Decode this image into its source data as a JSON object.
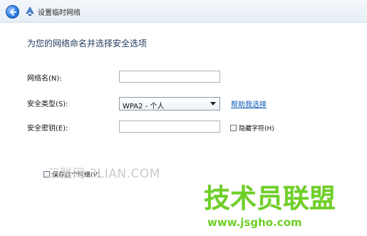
{
  "window": {
    "title": "设置临时网络",
    "back_icon": "back-arrow-icon",
    "network_icon": "network-icon"
  },
  "main": {
    "heading": "为您的网络命名并选择安全选项",
    "network_name_label": "网络名(N):",
    "network_name_value": "",
    "security_type_label": "安全类型(S):",
    "security_type_value": "WPA2 - 个人",
    "help_link": "帮助我选择",
    "security_key_label": "安全密钥(E):",
    "security_key_value": "",
    "hide_chars_label": "隐藏字符(H)",
    "save_network_label": "保存这个网络(V)"
  },
  "watermarks": {
    "site_text": "三联网 3LIAN.COM",
    "brand_text": "技术员联盟",
    "brand_url": "www.jsgho.com"
  },
  "colors": {
    "heading": "#1e395b",
    "link": "#0b57b3",
    "watermark_green": "#6ecf26",
    "watermark_gray": "#c9cbcd"
  }
}
